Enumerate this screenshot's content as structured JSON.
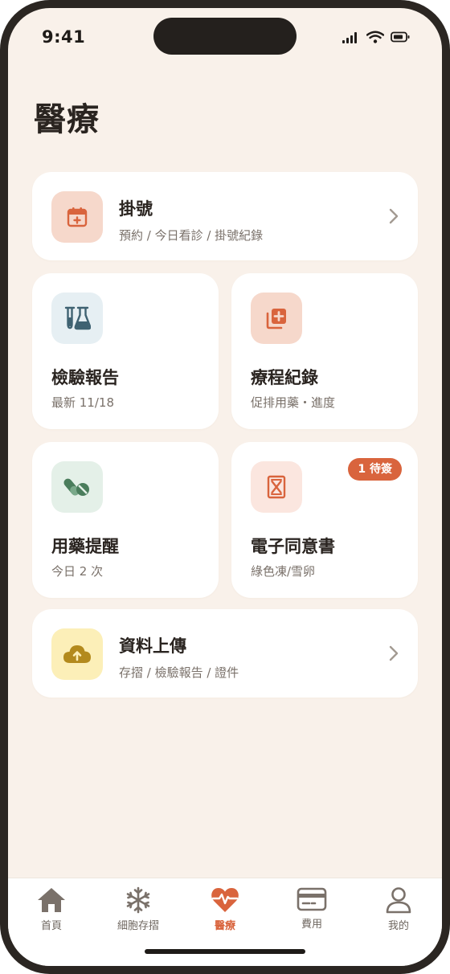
{
  "status_bar": {
    "time": "9:41"
  },
  "page": {
    "title": "醫療"
  },
  "cards": {
    "registration": {
      "title": "掛號",
      "subtitle": "預約 / 今日看診 / 掛號紀錄",
      "icon": "calendar-plus-icon"
    },
    "lab_report": {
      "title": "檢驗報告",
      "subtitle": "最新 11/18",
      "icon": "flask-icon"
    },
    "treatment": {
      "title": "療程紀錄",
      "subtitle": "促排用藥・進度",
      "icon": "medical-records-icon"
    },
    "medication": {
      "title": "用藥提醒",
      "subtitle": "今日 2 次",
      "icon": "pills-icon"
    },
    "consent": {
      "title": "電子同意書",
      "subtitle": "綠色凍/雪卵",
      "icon": "document-x-icon",
      "badge": "1 待簽"
    },
    "upload": {
      "title": "資料上傳",
      "subtitle": "存摺 / 檢驗報告 / 證件",
      "icon": "cloud-upload-icon"
    }
  },
  "tabbar": {
    "items": [
      {
        "label": "首頁",
        "icon": "home-icon"
      },
      {
        "label": "細胞存摺",
        "icon": "snowflake-icon"
      },
      {
        "label": "醫療",
        "icon": "heartbeat-icon",
        "active": true
      },
      {
        "label": "費用",
        "icon": "credit-card-icon"
      },
      {
        "label": "我的",
        "icon": "user-icon"
      }
    ]
  },
  "colors": {
    "background": "#f9f1ea",
    "accent": "#d9643d",
    "registration_tile": "#f6d8cb",
    "lab_tile": "#e6eff3",
    "treatment_tile": "#f6d8cb",
    "medication_tile": "#e4f0e8",
    "consent_tile": "#fbe6df",
    "upload_tile": "#fcefb8"
  }
}
